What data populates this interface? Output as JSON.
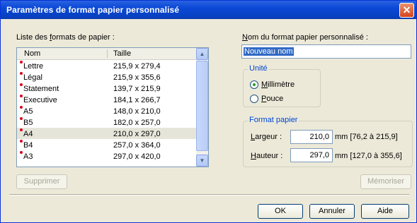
{
  "window": {
    "title": "Paramètres de format papier personnalisé",
    "close_glyph": "✕"
  },
  "left": {
    "list_label_prefix": "Liste des ",
    "list_label_u": "f",
    "list_label_suffix": "ormats de papier :",
    "columns": {
      "name": "Nom",
      "size": "Taille"
    },
    "rows": [
      {
        "name": "Lettre",
        "size": "215,9 x 279,4"
      },
      {
        "name": "Légal",
        "size": "215,9 x 355,6"
      },
      {
        "name": "Statement",
        "size": "139,7 x 215,9"
      },
      {
        "name": "Executive",
        "size": "184,1 x 266,7"
      },
      {
        "name": "A5",
        "size": "148,0 x 210,0"
      },
      {
        "name": "B5",
        "size": "182,0 x 257,0"
      },
      {
        "name": "A4",
        "size": "210,0 x 297,0",
        "selected": true
      },
      {
        "name": "B4",
        "size": "257,0 x 364,0"
      },
      {
        "name": "A3",
        "size": "297,0 x 420,0"
      }
    ],
    "delete_label": "Supprimer"
  },
  "right": {
    "name_label_u": "N",
    "name_label_rest": "om du format papier personnalisé :",
    "name_value": "Nouveau nom",
    "unit_group": "Unité",
    "unit_options": [
      {
        "label_u": "M",
        "label_rest": "illimètre",
        "checked": true
      },
      {
        "label_u": "P",
        "label_rest": "ouce",
        "checked": false
      }
    ],
    "format_group": "Format papier",
    "width_label_u": "L",
    "width_label_rest": "argeur :",
    "width_value": "210,0",
    "width_range": "mm [76,2 à 215,9]",
    "height_label_u": "H",
    "height_label_rest": "auteur :",
    "height_value": "297,0",
    "height_range": "mm [127,0 à 355,6]",
    "save_label": "Mémoriser"
  },
  "footer": {
    "ok": "OK",
    "cancel": "Annuler",
    "help": "Aide"
  }
}
